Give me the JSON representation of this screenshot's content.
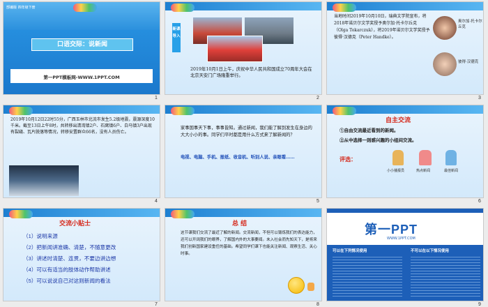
{
  "colors": {
    "accent": "#1d7fd1",
    "red": "#d52b1e",
    "blue": "#1f4fb8",
    "selection": "#e98a2a"
  },
  "slides": [
    {
      "num": "1",
      "header": "部编版 四年级下册",
      "title": "口语交际：说新闻",
      "subtitle": "第一PPT模板网-WWW.1PPT.COM"
    },
    {
      "num": "2",
      "badge": "新课导入",
      "text": "2019年10月1日上午，庆祝中华人民共和国成立70周年大会在北京天安门广场隆重举行。"
    },
    {
      "num": "3",
      "text": "当地时间2019年10月10日，瑞典文学院宣布，将2018年诺贝尔文学奖授予奥尔加·托卡尔丘克（Olga Tokarczuk），将2019年诺贝尔文学奖授予彼得·汉德克（Peter Handke）。",
      "name1": "奥尔加·托卡尔丘克",
      "name2": "彼得·汉德克"
    },
    {
      "num": "4",
      "text": "2019年10月12日22时55分，广西玉林市北流市发生5.2级地震，震源深度10千米。截至13日上午8时，共转移出清湾镇2户、石窝镇6户、白马镇3户出现有裂缝、瓦片脱落等情况，转移安置群众66名，没有人员伤亡。"
    },
    {
      "num": "5",
      "text": "家事国事天下事，事事皆知。通过新闻，我们能了解到发生在身边的大大小小的事。同学们平时都是用什么方式来了解新闻的？",
      "media": "电视、电脑、手机、报纸、收音机、听别人说、亲眼看……"
    },
    {
      "num": "6",
      "title": "自主交流",
      "item1": "①自由交流最近看到的新闻。",
      "item2": "②从中选择一则感兴趣的小组间交流。",
      "rate": "评选：",
      "awards": [
        "小小播报员",
        "热点新闻",
        "最佳新闻"
      ]
    },
    {
      "num": "7",
      "title": "交流小贴士",
      "tips": [
        "（1）说明来源",
        "（2）把新闻讲准确、清楚，不随意更改",
        "（3）讲述时清楚、连贯，不要边讲边想",
        "（4）可以有适当的肢体动作帮助讲述",
        "（5）可以说说自己对这则新闻的看法"
      ]
    },
    {
      "num": "8",
      "title": "总 结",
      "text": "这节课我们交流了最近了解的新闻。交流新闻，不但可以锻炼我们的表达能力，还可以开阔我们的眼界，了解国内外的大事要闻。未入社会而先知天下，是将来我们创新国家建设重任的基础。希望同学们课下也能关注新闻、观察生活、关心时事。"
    },
    {
      "num": "9",
      "logo": "第一PPT",
      "url": "WWW.1PPT.COM",
      "col1": "可以在下列情况使用",
      "col2": "不可以在以下情况使用"
    }
  ]
}
